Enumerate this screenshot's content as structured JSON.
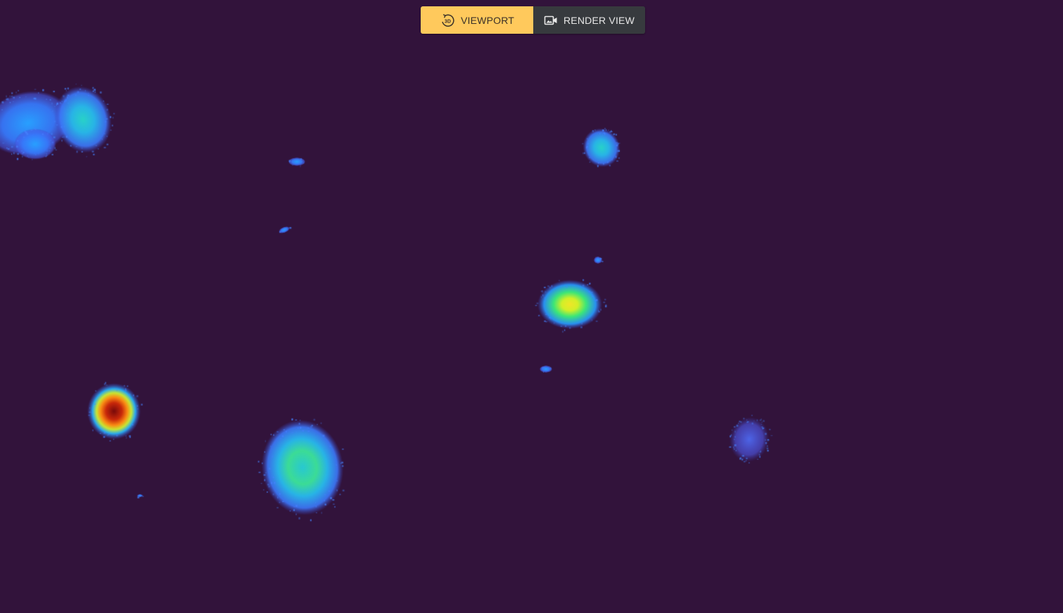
{
  "toolbar": {
    "viewport_label": "VIEWPORT",
    "viewport_icon": "rotate-3d-icon",
    "viewport_icon_text": "3D",
    "render_label": "RENDER VIEW",
    "render_icon": "camera-image-icon",
    "active_mode": "viewport"
  },
  "colors": {
    "background": "#32133b",
    "active_button": "#ffc95c",
    "inactive_button": "#373a3e"
  },
  "viewport": {
    "colormap": "turbo"
  }
}
